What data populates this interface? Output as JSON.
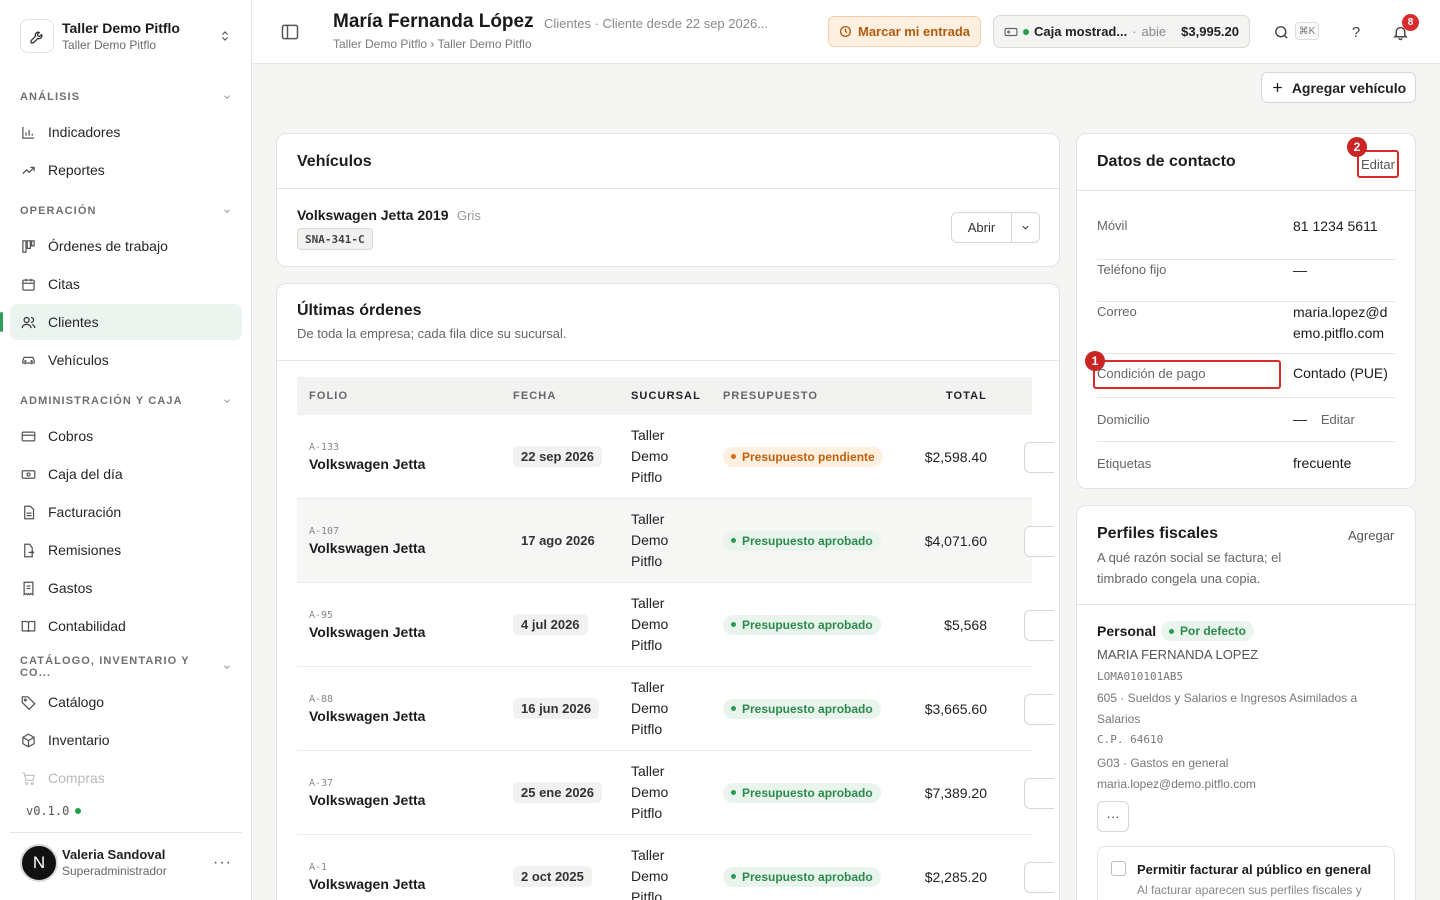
{
  "org": {
    "name": "Taller Demo Pitflo",
    "sub": "Taller Demo Pitflo"
  },
  "nav": {
    "sections": [
      {
        "label": "ANÁLISIS",
        "items": [
          "Indicadores",
          "Reportes"
        ]
      },
      {
        "label": "OPERACIÓN",
        "items": [
          "Órdenes de trabajo",
          "Citas",
          "Clientes",
          "Vehículos"
        ]
      },
      {
        "label": "ADMINISTRACIÓN Y CAJA",
        "items": [
          "Cobros",
          "Caja del día",
          "Facturación",
          "Remisiones",
          "Gastos",
          "Contabilidad"
        ]
      },
      {
        "label": "CATÁLOGO, INVENTARIO Y CO...",
        "items": [
          "Catálogo",
          "Inventario",
          "Compras"
        ]
      }
    ],
    "active": "Clientes"
  },
  "version": "v0.1.0",
  "user": {
    "initial": "N",
    "name": "Valeria Sandoval",
    "role": "Superadministrador"
  },
  "header": {
    "title": "María Fernanda López",
    "meta": "Clientes · Cliente desde 22 sep 2026...",
    "breadcrumb": "Taller Demo Pitflo › Taller Demo Pitflo",
    "entrada_label": "Marcar mi entrada",
    "caja_name": "Caja mostrad...",
    "caja_state": "abie",
    "caja_amount": "$3,995.20",
    "shortcut": "⌘K",
    "help": "?",
    "notifications": "8"
  },
  "actions": {
    "add_vehicle": "Agregar vehículo"
  },
  "vehicles": {
    "title": "Vehículos",
    "items": [
      {
        "name": "Volkswagen Jetta 2019",
        "color": "Gris",
        "plate": "SNA-341-C",
        "open_label": "Abrir"
      }
    ]
  },
  "orders": {
    "title": "Últimas órdenes",
    "subtitle": "De toda la empresa; cada fila dice su sucursal.",
    "columns": [
      "FOLIO",
      "FECHA",
      "SUCURSAL",
      "PRESUPUESTO",
      "TOTAL"
    ],
    "rows": [
      {
        "folio": "A-133",
        "vehicle": "Volkswagen Jetta",
        "date": "22 sep 2026",
        "branch": [
          "Taller",
          "Demo",
          "Pitflo"
        ],
        "status": "Presupuesto pendiente",
        "status_kind": "pending",
        "total": "$2,598.40"
      },
      {
        "folio": "A-107",
        "vehicle": "Volkswagen Jetta",
        "date": "17 ago 2026",
        "branch": [
          "Taller",
          "Demo",
          "Pitflo"
        ],
        "status": "Presupuesto aprobado",
        "status_kind": "approved",
        "total": "$4,071.60"
      },
      {
        "folio": "A-95",
        "vehicle": "Volkswagen Jetta",
        "date": "4 jul 2026",
        "branch": [
          "Taller",
          "Demo",
          "Pitflo"
        ],
        "status": "Presupuesto aprobado",
        "status_kind": "approved",
        "total": "$5,568"
      },
      {
        "folio": "A-88",
        "vehicle": "Volkswagen Jetta",
        "date": "16 jun 2026",
        "branch": [
          "Taller",
          "Demo",
          "Pitflo"
        ],
        "status": "Presupuesto aprobado",
        "status_kind": "approved",
        "total": "$3,665.60"
      },
      {
        "folio": "A-37",
        "vehicle": "Volkswagen Jetta",
        "date": "25 ene 2026",
        "branch": [
          "Taller",
          "Demo",
          "Pitflo"
        ],
        "status": "Presupuesto aprobado",
        "status_kind": "approved",
        "total": "$7,389.20"
      },
      {
        "folio": "A-1",
        "vehicle": "Volkswagen Jetta",
        "date": "2 oct 2025",
        "branch": [
          "Taller",
          "Demo",
          "Pitflo"
        ],
        "status": "Presupuesto aprobado",
        "status_kind": "approved",
        "total": "$2,285.20"
      }
    ]
  },
  "contact": {
    "title": "Datos de contacto",
    "edit_label": "Editar",
    "fields": {
      "movil": {
        "label": "Móvil",
        "value": "81 1234 5611"
      },
      "fijo": {
        "label": "Teléfono fijo",
        "value": "—"
      },
      "correo": {
        "label": "Correo",
        "value": "maria.lopez@demo.pitflo.com"
      },
      "condicion": {
        "label": "Condición de pago",
        "value": "Contado (PUE)"
      },
      "domicilio": {
        "label": "Domicilio",
        "value": "—",
        "edit": "Editar"
      },
      "etiquetas": {
        "label": "Etiquetas",
        "value": "frecuente"
      }
    }
  },
  "markers": {
    "one": "1",
    "two": "2"
  },
  "fiscal": {
    "title": "Perfiles fiscales",
    "add_label": "Agregar",
    "description": "A qué razón social se factura; el timbrado congela una copia.",
    "profile": {
      "name": "Personal",
      "default_label": "Por defecto",
      "legal_name": "MARIA FERNANDA LOPEZ",
      "rfc": "LOMA010101AB5",
      "regime": "605 · Sueldos y Salarios e Ingresos Asimilados a Salarios",
      "cp": "C.P. 64610",
      "cfdi_use": "G03 · Gastos en general",
      "email": "maria.lopez@demo.pitflo.com",
      "more": "···"
    },
    "allow_title": "Permitir facturar al público en general",
    "allow_desc": "Al facturar aparecen sus perfiles fiscales y"
  }
}
